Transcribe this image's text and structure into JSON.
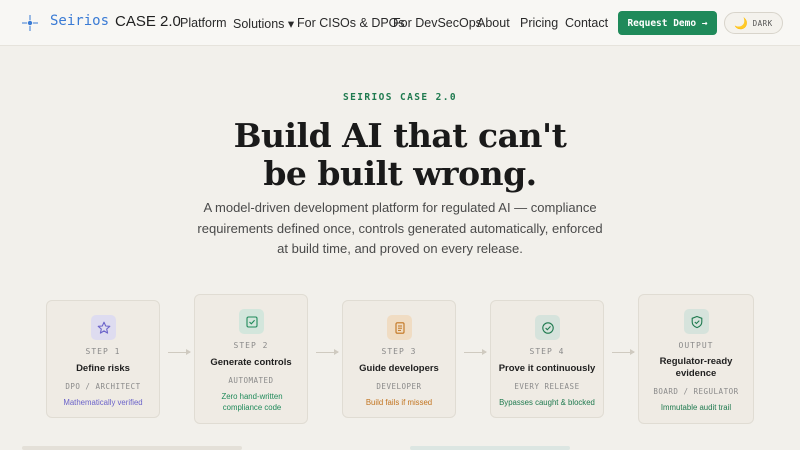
{
  "nav": {
    "logo_text": "Seirios",
    "logo_sub": "CASE 2.0",
    "links": [
      {
        "label": "Platform"
      },
      {
        "label": "Solutions ▾"
      },
      {
        "label": "For CISOs & DPOs"
      },
      {
        "label": "For DevSecOps"
      },
      {
        "label": "About"
      },
      {
        "label": "Pricing"
      },
      {
        "label": "Contact"
      }
    ],
    "demo_label": "Request Demo →",
    "dark_label": "DARK"
  },
  "hero": {
    "eyebrow": "SEIRIOS CASE 2.0",
    "headline_line1": "Build AI that can't",
    "headline_line2": "be built wrong.",
    "sub_line1": "A model-driven development platform for regulated AI — compliance",
    "sub_line2": "requirements defined once, controls generated automatically, enforced",
    "sub_line3": "at build time, and proved on every release."
  },
  "steps": [
    {
      "num": "STEP 1",
      "title": "Define risks",
      "role": "DPO / ARCHITECT",
      "note": "Mathematically verified",
      "icon": "star-icon",
      "accent": "#6b63c9",
      "icon_bg": "#dedcf0"
    },
    {
      "num": "STEP 2",
      "title": "Generate controls",
      "role": "AUTOMATED",
      "note": "Zero hand-written compliance code",
      "icon": "check-square-icon",
      "accent": "#1f8a5a",
      "icon_bg": "#d3e6dc"
    },
    {
      "num": "STEP 3",
      "title": "Guide developers",
      "role": "DEVELOPER",
      "note": "Build fails if missed",
      "icon": "document-icon",
      "accent": "#c2741f",
      "icon_bg": "#f0dcc3"
    },
    {
      "num": "STEP 4",
      "title": "Prove it continuously",
      "role": "EVERY RELEASE",
      "note": "Bypasses caught & blocked",
      "icon": "check-circle-icon",
      "accent": "#1f7a4f",
      "icon_bg": "#d6e3dc"
    },
    {
      "num": "OUTPUT",
      "title": "Regulator-ready evidence",
      "role": "BOARD / REGULATOR",
      "note": "Immutable audit trail",
      "icon": "shield-check-icon",
      "accent": "#1f7a4f",
      "icon_bg": "#d6e3dc"
    }
  ]
}
